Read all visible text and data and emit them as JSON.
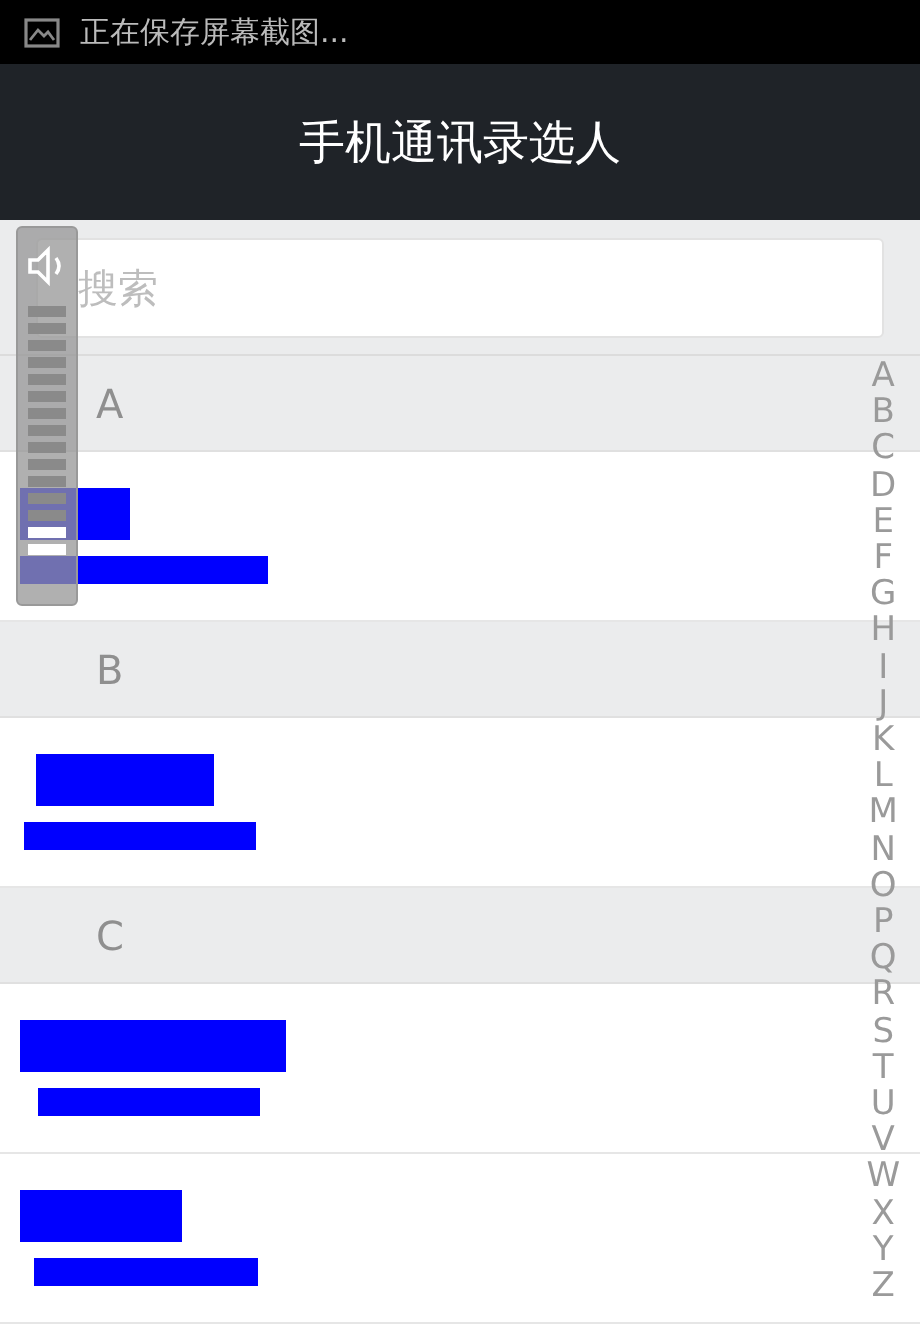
{
  "status_bar": {
    "notification": "正在保存屏幕截图..."
  },
  "title_bar": {
    "title": "手机通讯录选人"
  },
  "search": {
    "placeholder": "搜索"
  },
  "sections": [
    {
      "letter": "A",
      "contacts": [
        {
          "redacted": true
        }
      ]
    },
    {
      "letter": "B",
      "contacts": [
        {
          "redacted": true
        }
      ]
    },
    {
      "letter": "C",
      "contacts": [
        {
          "redacted": true
        },
        {
          "redacted": true
        }
      ]
    }
  ],
  "index_letters": [
    "A",
    "B",
    "C",
    "D",
    "E",
    "F",
    "G",
    "H",
    "I",
    "J",
    "K",
    "L",
    "M",
    "N",
    "O",
    "P",
    "Q",
    "R",
    "S",
    "T",
    "U",
    "V",
    "W",
    "X",
    "Y",
    "Z"
  ],
  "volume_overlay": {
    "level": 0.13
  }
}
